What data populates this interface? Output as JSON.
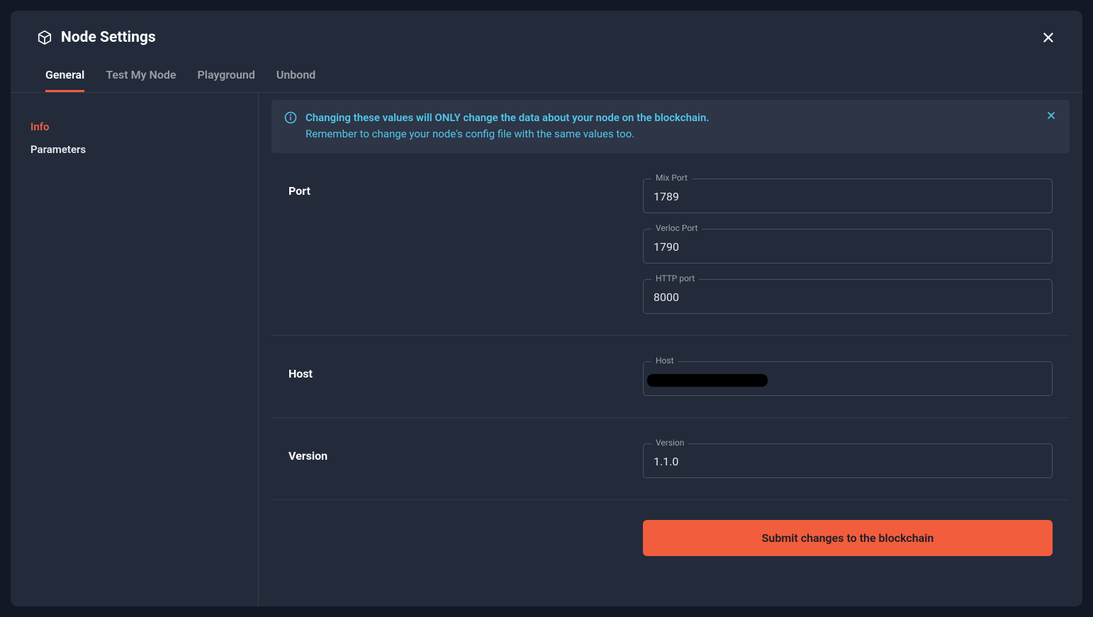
{
  "header": {
    "title": "Node Settings"
  },
  "tabs": [
    {
      "label": "General",
      "active": true
    },
    {
      "label": "Test My Node",
      "active": false
    },
    {
      "label": "Playground",
      "active": false
    },
    {
      "label": "Unbond",
      "active": false
    }
  ],
  "sidebar": [
    {
      "label": "Info",
      "active": true
    },
    {
      "label": "Parameters",
      "active": false
    }
  ],
  "alert": {
    "line1": "Changing these values will ONLY change the data about your node on the blockchain.",
    "line2": "Remember to change your node's config file with the same values too."
  },
  "sections": {
    "port": {
      "label": "Port",
      "fields": [
        {
          "label": "Mix Port",
          "value": "1789"
        },
        {
          "label": "Verloc Port",
          "value": "1790"
        },
        {
          "label": "HTTP port",
          "value": "8000"
        }
      ]
    },
    "host": {
      "label": "Host",
      "fields": [
        {
          "label": "Host",
          "value": "",
          "redacted": true
        }
      ]
    },
    "version": {
      "label": "Version",
      "fields": [
        {
          "label": "Version",
          "value": "1.1.0"
        }
      ]
    }
  },
  "submit": {
    "label": "Submit changes to the blockchain"
  }
}
